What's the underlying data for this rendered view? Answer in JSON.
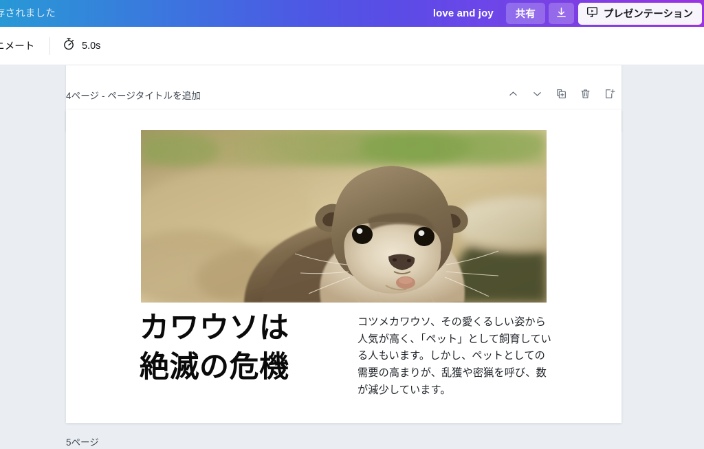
{
  "top_bar": {
    "saved_status": "保存されました",
    "design_name": "love and joy",
    "share_label": "共有",
    "download_icon": "download-icon",
    "present_label": "プレゼンテーション",
    "present_icon": "presentation-screen-icon",
    "gradient_start": "#2798d6",
    "gradient_mid": "#5a4ce6",
    "gradient_end": "#9a33e0"
  },
  "sub_bar": {
    "animate_label": "アニメート",
    "timer_icon": "stopwatch-icon",
    "timer_value": "5.0s"
  },
  "page": {
    "title": "4ページ - ページタイトルを追加",
    "tools": [
      {
        "name": "move-up-button",
        "icon": "chevron-up-icon"
      },
      {
        "name": "move-down-button",
        "icon": "chevron-down-icon"
      },
      {
        "name": "duplicate-page-button",
        "icon": "duplicate-icon"
      },
      {
        "name": "delete-page-button",
        "icon": "trash-icon"
      },
      {
        "name": "add-page-button",
        "icon": "add-page-icon"
      }
    ]
  },
  "slide": {
    "photo_alt": "otter-photo",
    "headline_line1": "カワウソは",
    "headline_line2": "絶滅の危機",
    "body": "コツメカワウソ、その愛くるしい姿から人気が高く、「ペット」として飼育している人もいます。しかし、ペットとしての需要の高まりが、乱獲や密猟を呼び、数が減少しています。"
  },
  "next_page": {
    "title": "5ページ"
  }
}
